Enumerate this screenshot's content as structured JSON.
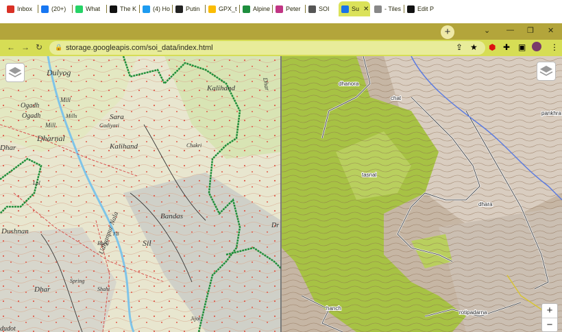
{
  "tabs": [
    {
      "title": "Inbox",
      "icon": "gmail-icon",
      "color": "#d93025"
    },
    {
      "title": "(20+)",
      "icon": "facebook-icon",
      "color": "#1877f2"
    },
    {
      "title": "What",
      "icon": "whatsapp-icon",
      "color": "#25d366"
    },
    {
      "title": "The K",
      "icon": "k-icon",
      "color": "#111111"
    },
    {
      "title": "(4) Ho",
      "icon": "twitter-icon",
      "color": "#1d9bf0"
    },
    {
      "title": "Putin",
      "icon": "wsj-icon",
      "color": "#222222"
    },
    {
      "title": "GPX_t",
      "icon": "drive-icon",
      "color": "#fbbc04"
    },
    {
      "title": "Alpine",
      "icon": "alpine-icon",
      "color": "#1e8e3e"
    },
    {
      "title": "Peter",
      "icon": "instagram-icon",
      "color": "#c13584"
    },
    {
      "title": "SOI",
      "icon": "lock-icon",
      "color": "#555555"
    },
    {
      "title": "Su",
      "icon": "globe-icon",
      "color": "#1a73e8"
    },
    {
      "title": "- Tiles",
      "icon": "globe-icon",
      "color": "#888888"
    },
    {
      "title": "Edit P",
      "icon": "edit-icon",
      "color": "#111111"
    }
  ],
  "address": {
    "url": "storage.googleapis.com/soi_data/index.html"
  },
  "map": {
    "left_labels": [
      {
        "text": "Dulyog",
        "style": "italic"
      },
      {
        "text": "Ogadh",
        "style": "italic"
      },
      {
        "text": "Mill",
        "style": "italic"
      },
      {
        "text": "Ogadh",
        "style": "italic"
      },
      {
        "text": "Mills",
        "style": "italic"
      },
      {
        "text": "Mill",
        "style": "italic"
      },
      {
        "text": "Dharnal",
        "style": "italic"
      },
      {
        "text": "Dhar",
        "style": "italic"
      },
      {
        "text": "Sara",
        "style": "italic"
      },
      {
        "text": "Gadiyari",
        "style": "italic"
      },
      {
        "text": "Kalihand",
        "style": "italic"
      },
      {
        "text": "Kalihand",
        "style": "italic"
      },
      {
        "text": "Chakri",
        "style": "italic"
      },
      {
        "text": "Lol",
        "style": "italic"
      },
      {
        "text": "Udlyanpur Nala",
        "style": "italic"
      },
      {
        "text": "Bandas",
        "style": "italic"
      },
      {
        "text": "Dushnan",
        "style": "italic"
      },
      {
        "text": "Bheli",
        "style": "italic"
      },
      {
        "text": "Sil",
        "style": "italic"
      },
      {
        "text": "Spring",
        "style": "italic"
      },
      {
        "text": "Shahi",
        "style": "italic"
      },
      {
        "text": "Dhar",
        "style": "italic"
      },
      {
        "text": "Jijot",
        "style": "italic"
      },
      {
        "text": "dudot",
        "style": "italic"
      },
      {
        "text": "Dhar",
        "style": "italic"
      },
      {
        "text": "Dr",
        "style": "italic"
      },
      {
        "text": "FB",
        "style": "italic"
      }
    ],
    "right_labels": [
      "dhanora",
      "chat",
      "pankhra",
      "tasnal",
      "dhara",
      "hanch",
      "rotipadarna"
    ],
    "colors": {
      "forest_outline": "#1f8f3a",
      "river": "#7fc4e8",
      "road": "#d9534f",
      "terrain_brown": "#9b7b5e",
      "forest_green": "#a7c244"
    },
    "zoom": {
      "in": "+",
      "out": "−"
    }
  }
}
